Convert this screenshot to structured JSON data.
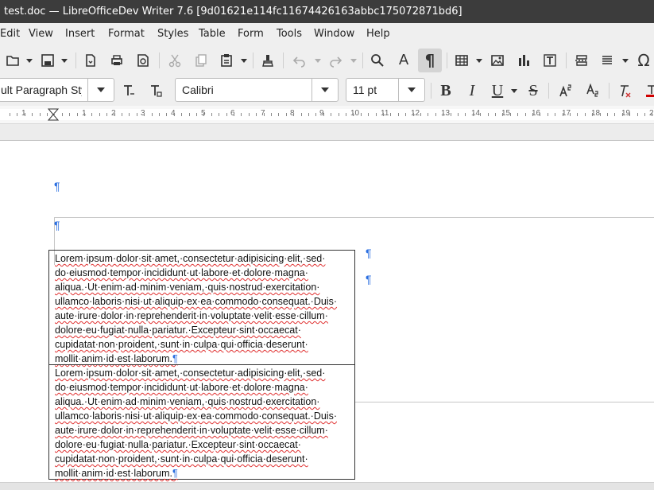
{
  "window": {
    "title": "test.doc — LibreOfficeDev Writer 7.6 [9d01621e114fc11674426163abbc175072871bd6]"
  },
  "menu": [
    "Edit",
    "View",
    "Insert",
    "Format",
    "Styles",
    "Table",
    "Form",
    "Tools",
    "Window",
    "Help"
  ],
  "toolbar2": {
    "paragraph_style": "ult Paragraph Sty",
    "font_name": "Calibri",
    "font_size": "11 pt"
  },
  "format_buttons": {
    "bold": "B",
    "italic": "I",
    "underline": "U",
    "strike": "S"
  },
  "ruler": {
    "numbers": [
      "1",
      "1",
      "2",
      "3",
      "4",
      "5",
      "6",
      "7",
      "8",
      "9",
      "10",
      "11",
      "12",
      "13",
      "14",
      "15",
      "16",
      "17",
      "18",
      "19",
      "2"
    ]
  },
  "document": {
    "pilcrow": "¶",
    "cell_lines": [
      "Lorem·ipsum·dolor·sit·amet,·consectetur·adipisicing·elit,·sed·",
      "do·eiusmod·tempor·incididunt·ut·labore·et·dolore·magna·",
      "aliqua.·Ut·enim·ad·minim·veniam,·quis·nostrud·exercitation·",
      "ullamco·laboris·nisi·ut·aliquip·ex·ea·commodo·consequat.·Duis·",
      "aute·irure·dolor·in·reprehenderit·in·voluptate·velit·esse·cillum·",
      "dolore·eu·fugiat·nulla·pariatur.·Excepteur·sint·occaecat·",
      "cupidatat·non·proident,·sunt·in·culpa·qui·officia·deserunt·",
      "mollit·anim·id·est·laborum."
    ]
  }
}
